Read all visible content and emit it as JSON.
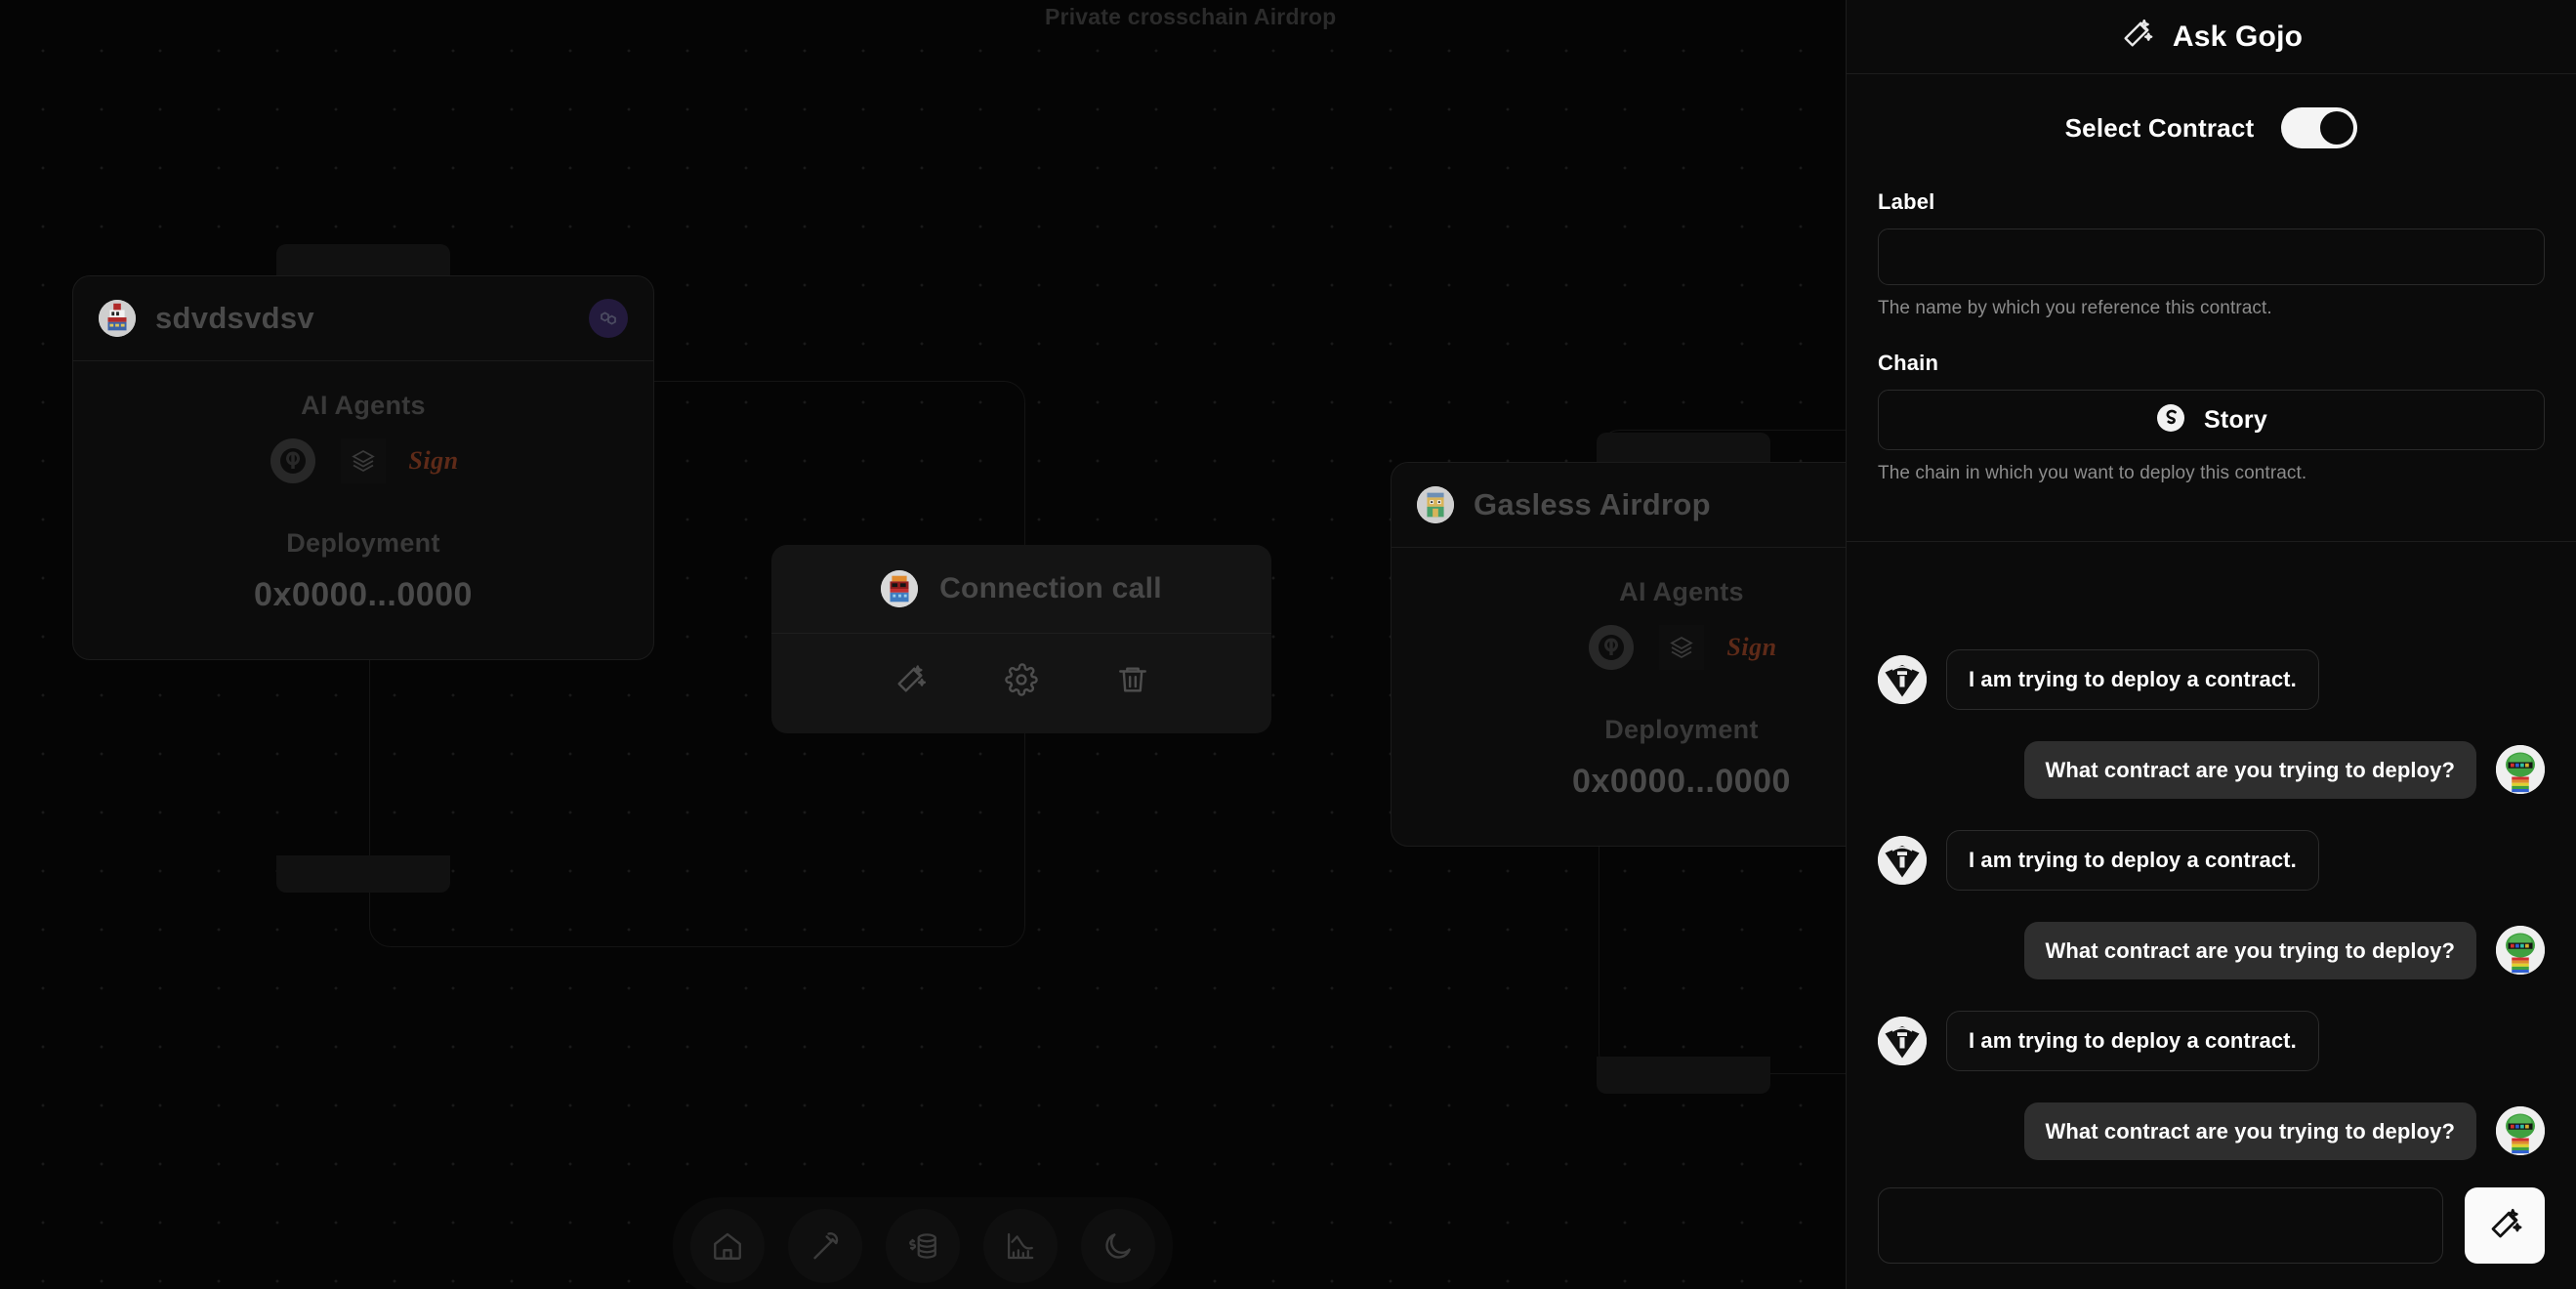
{
  "canvas": {
    "title": "Private crosschain Airdrop",
    "nodes": [
      {
        "id": "node-sdvdsvdsv",
        "title": "sdvdsvdsv",
        "chain_badge": "polygon-icon",
        "agents_label": "AI Agents",
        "agents": [
          "agent-circle-icon",
          "agent-box-icon",
          "sign-logo"
        ],
        "deployment_label": "Deployment",
        "deployment_address": "0x0000...0000"
      },
      {
        "id": "node-gasless-airdrop",
        "title": "Gasless Airdrop",
        "agents_label": "AI Agents",
        "agents": [
          "agent-circle-icon",
          "agent-box-icon",
          "sign-logo"
        ],
        "deployment_label": "Deployment",
        "deployment_address": "0x0000...0000"
      }
    ],
    "connection_panel": {
      "title": "Connection call",
      "actions": [
        "magic-wand-icon",
        "gear-icon",
        "trash-icon"
      ]
    },
    "dock": [
      {
        "name": "home-icon"
      },
      {
        "name": "hammer-icon"
      },
      {
        "name": "coins-icon"
      },
      {
        "name": "chart-icon"
      },
      {
        "name": "moon-icon"
      }
    ]
  },
  "panel": {
    "header": {
      "title": "Ask Gojo",
      "icon": "magic-wand-icon"
    },
    "select_contract": {
      "label": "Select Contract",
      "enabled": true
    },
    "label_field": {
      "label": "Label",
      "value": "",
      "placeholder": "",
      "hint": "The name by which you reference this contract."
    },
    "chain_field": {
      "label": "Chain",
      "selected": "Story",
      "icon": "story-logo",
      "hint": "The chain in which you want to deploy this contract."
    },
    "chat": {
      "messages": [
        {
          "role": "bot",
          "text": "I am trying to deploy a contract."
        },
        {
          "role": "user",
          "text": "What contract are you trying to deploy?"
        },
        {
          "role": "bot",
          "text": "I am trying to deploy a contract."
        },
        {
          "role": "user",
          "text": "What contract are you trying to deploy?"
        },
        {
          "role": "bot",
          "text": "I am trying to deploy a contract."
        },
        {
          "role": "user",
          "text": "What contract are you trying to deploy?"
        }
      ]
    },
    "composer": {
      "value": "",
      "placeholder": "",
      "send_icon": "magic-wand-icon"
    }
  },
  "colors": {
    "background": "#050505",
    "panel_background": "#0b0b0b",
    "card_background": "#0c0c0c",
    "border": "#1d1d1d",
    "muted_text": "#4a4a4a",
    "hint_text": "#8c8c8c",
    "user_bubble": "#2e2e2e",
    "accent_white": "#fafafa",
    "polygon_purple": "#231a3d",
    "sign_orange": "#5e2a18"
  }
}
